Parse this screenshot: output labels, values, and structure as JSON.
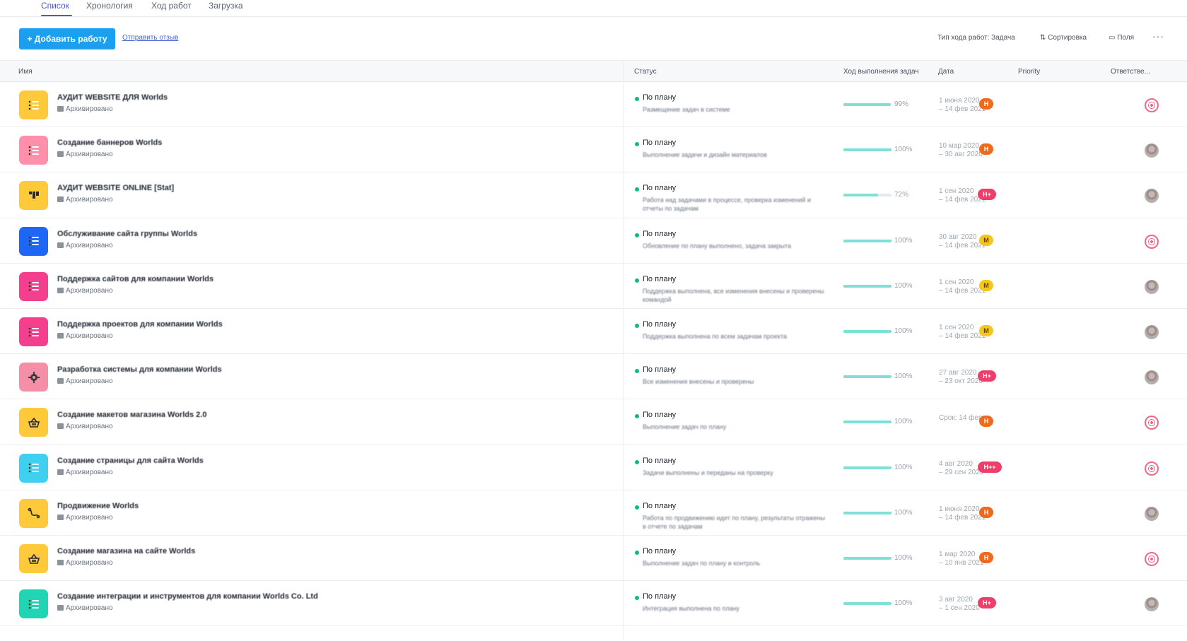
{
  "tabs": [
    "Список",
    "Хронология",
    "Ход работ",
    "Загрузка"
  ],
  "toolbar": {
    "add_label": "+ Добавить работу",
    "feedback_label": "Отправить отзыв",
    "progress_type": "Тип хода работ: Задача",
    "sort_label": "Сортировка",
    "fields_label": "Поля",
    "more": "···"
  },
  "columns": {
    "name": "Имя",
    "status": "Статус",
    "progress": "Ход выполнения задач",
    "date": "Дата",
    "priority": "Priority",
    "assignee": "Ответстве..."
  },
  "colors": {
    "accent": "#4b58d8",
    "add_button": "#1aa0ef",
    "status_dot": "#12b886",
    "progress_fill": "#7fe0d8",
    "prio_h": "#f06a1e",
    "prio_hplus": "#ef3e6a",
    "prio_m": "#f7c61a"
  },
  "rows": [
    {
      "name": "АУДИТ WEBSITE ДЛЯ Worlds",
      "archived": "Архивировано",
      "icon": "list-icon",
      "icon_color": "#ffc93c",
      "status": "По плану",
      "status_desc": "Размещение задач в системе",
      "progress": 0.99,
      "progress_label": "99%",
      "date": "1 июня 2020\n– 14 фев 2021",
      "priority": "H",
      "prio_color": "#f06a1e",
      "assignee": "target"
    },
    {
      "name": "Создание баннеров Worlds",
      "archived": "Архивировано",
      "icon": "list-icon",
      "icon_color": "#ff8fab",
      "status": "По плану",
      "status_desc": "Выполнение задачи и дизайн материалов",
      "progress": 1.0,
      "progress_label": "100%",
      "date": "10 мар 2020\n– 30 авг 2020",
      "priority": "H",
      "prio_color": "#f06a1e",
      "assignee": "photo"
    },
    {
      "name": "АУДИТ WEBSITE ONLINE [Stat]",
      "archived": "Архивировано",
      "icon": "board-icon",
      "icon_color": "#ffc93c",
      "status": "По плану",
      "status_desc": "Работа над задачами в процессе, проверка изменений и отчеты по задачам",
      "progress": 0.72,
      "progress_label": "72%",
      "date": "1 сен 2020\n– 14 фев 2021",
      "priority": "H+",
      "prio_color": "#ef3e6a",
      "assignee": "photo"
    },
    {
      "name": "Обслуживание сайта группы Worlds",
      "archived": "Архивировано",
      "icon": "list-icon",
      "icon_color": "#1e66f5",
      "status": "По плану",
      "status_desc": "Обновление по плану выполнено, задача закрыта",
      "progress": 1.0,
      "progress_label": "100%",
      "date": "30 авг 2020\n– 14 фев 2021",
      "priority": "M",
      "prio_color": "#f7c61a",
      "assignee": "target"
    },
    {
      "name": "Поддержка сайтов для компании Worlds",
      "archived": "Архивировано",
      "icon": "list-icon",
      "icon_color": "#f43f8f",
      "status": "По плану",
      "status_desc": "Поддержка выполнена, все изменения внесены и проверены командой",
      "progress": 1.0,
      "progress_label": "100%",
      "date": "1 сен 2020\n– 14 фев 2021",
      "priority": "M",
      "prio_color": "#f7c61a",
      "assignee": "photo"
    },
    {
      "name": "Поддержка проектов для компании Worlds",
      "archived": "Архивировано",
      "icon": "list-icon",
      "icon_color": "#f43f8f",
      "status": "По плану",
      "status_desc": "Поддержка выполнена по всем задачам проекта",
      "progress": 1.0,
      "progress_label": "100%",
      "date": "1 сен 2020\n– 14 фев 2021",
      "priority": "M",
      "prio_color": "#f7c61a",
      "assignee": "photo"
    },
    {
      "name": "Разработка системы для компании Worlds",
      "archived": "Архивировано",
      "icon": "gear-icon",
      "icon_color": "#f58fa8",
      "status": "По плану",
      "status_desc": "Все изменения внесены и проверены",
      "progress": 1.0,
      "progress_label": "100%",
      "date": "27 авг 2020\n– 23 окт 2020",
      "priority": "H+",
      "prio_color": "#ef3e6a",
      "assignee": "photo"
    },
    {
      "name": "Создание макетов магазина Worlds 2.0",
      "archived": "Архивировано",
      "icon": "basket-icon",
      "icon_color": "#ffc93c",
      "status": "По плану",
      "status_desc": "Выполнение задач по плану",
      "progress": 1.0,
      "progress_label": "100%",
      "date": "Срок: 14 фев",
      "priority": "H",
      "prio_color": "#f06a1e",
      "assignee": "target"
    },
    {
      "name": "Создание страницы для сайта Worlds",
      "archived": "Архивировано",
      "icon": "list-icon",
      "icon_color": "#3fd0f0",
      "status": "По плану",
      "status_desc": "Задачи выполнены и переданы на проверку",
      "progress": 1.0,
      "progress_label": "100%",
      "date": "4 авг 2020\n– 29 сен 2020",
      "priority": "H++",
      "prio_color": "#ef3e6a",
      "assignee": "target"
    },
    {
      "name": "Продвижение Worlds",
      "archived": "Архивировано",
      "icon": "route-icon",
      "icon_color": "#ffc93c",
      "status": "По плану",
      "status_desc": "Работа по продвижению идет по плану, результаты отражены в отчете по задачам",
      "progress": 1.0,
      "progress_label": "100%",
      "date": "1 июня 2020\n– 14 фев 2021",
      "priority": "H",
      "prio_color": "#f06a1e",
      "assignee": "photo"
    },
    {
      "name": "Создание магазина на сайте Worlds",
      "archived": "Архивировано",
      "icon": "basket-icon",
      "icon_color": "#ffc93c",
      "status": "По плану",
      "status_desc": "Выполнение задач по плану и контроль",
      "progress": 1.0,
      "progress_label": "100%",
      "date": "1 мар 2020\n– 10 янв 2021",
      "priority": "H",
      "prio_color": "#f06a1e",
      "assignee": "target"
    },
    {
      "name": "Создание интеграции и инструментов для компании Worlds Co. Ltd",
      "archived": "Архивировано",
      "icon": "list-icon",
      "icon_color": "#20d4b4",
      "status": "По плану",
      "status_desc": "Интеграция выполнена по плану",
      "progress": 1.0,
      "progress_label": "100%",
      "date": "3 авг 2020\n– 1 сен 2020",
      "priority": "H+",
      "prio_color": "#ef3e6a",
      "assignee": "photo"
    }
  ]
}
